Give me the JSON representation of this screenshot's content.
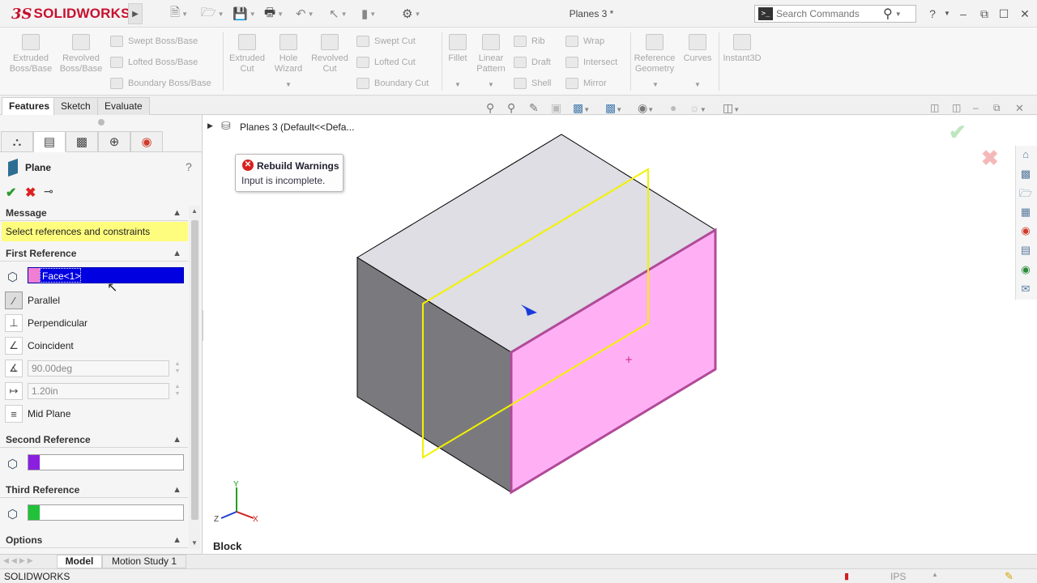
{
  "app": {
    "brand_prefix": "3S",
    "brand": "SOLIDWORKS",
    "doc_title": "Planes 3 *"
  },
  "search": {
    "placeholder": "Search Commands"
  },
  "toolbar": {
    "extruded_boss": "Extruded Boss/Base",
    "revolved_boss": "Revolved Boss/Base",
    "swept_boss": "Swept Boss/Base",
    "lofted_boss": "Lofted Boss/Base",
    "boundary_boss": "Boundary Boss/Base",
    "extruded_cut": "Extruded Cut",
    "hole_wizard": "Hole Wizard",
    "revolved_cut": "Revolved Cut",
    "swept_cut": "Swept Cut",
    "lofted_cut": "Lofted Cut",
    "boundary_cut": "Boundary Cut",
    "fillet": "Fillet",
    "linear_pattern": "Linear Pattern",
    "rib": "Rib",
    "draft": "Draft",
    "shell": "Shell",
    "wrap": "Wrap",
    "intersect": "Intersect",
    "mirror": "Mirror",
    "reference_geometry": "Reference Geometry",
    "curves": "Curves",
    "instant3d": "Instant3D"
  },
  "tabs": [
    "Features",
    "Sketch",
    "Evaluate"
  ],
  "panel": {
    "title": "Plane",
    "help": "?",
    "message_head": "Message",
    "message_text": "Select references and constraints",
    "first_ref_head": "First Reference",
    "first_ref_value": "Face<1>",
    "first_ref_color": "#f07ed2",
    "parallel": "Parallel",
    "perpendicular": "Perpendicular",
    "coincident": "Coincident",
    "angle_value": "90.00deg",
    "distance_value": "1.20in",
    "mid_plane": "Mid Plane",
    "second_ref_head": "Second Reference",
    "second_ref_color": "#8a1fe0",
    "third_ref_head": "Third Reference",
    "third_ref_color": "#22c13a",
    "options_head": "Options"
  },
  "tree": {
    "root": "Planes 3  (Default<<Defa..."
  },
  "warning": {
    "title": "Rebuild Warnings",
    "text": "Input is incomplete."
  },
  "viewport": {
    "label": "Block",
    "axis_x": "X",
    "axis_y": "Y",
    "axis_z": "Z"
  },
  "bottom_tabs": [
    "Model",
    "Motion Study 1"
  ],
  "status": {
    "left": "SOLIDWORKS",
    "units": "IPS"
  },
  "colors": {
    "accent": "#c8102e",
    "selection_blue": "#0000e0",
    "face_pink": "#ffb0f5",
    "plane_yellow": "#f2f200"
  }
}
